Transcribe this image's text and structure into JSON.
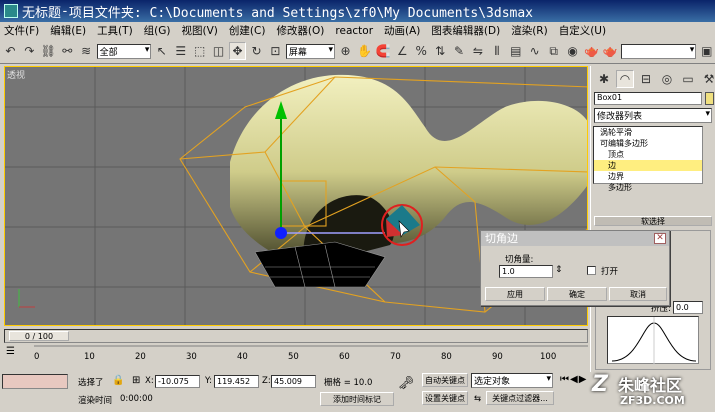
{
  "window": {
    "title_app": "无标题",
    "title_separator": " - ",
    "title_project": "项目文件夹: C:\\Documents and Settings\\zf0\\My Documents\\3dsmax"
  },
  "menu": [
    "文件(F)",
    "编辑(E)",
    "工具(T)",
    "组(G)",
    "视图(V)",
    "创建(C)",
    "修改器(O)",
    "reactor",
    "动画(A)",
    "图表编辑器(D)",
    "渲染(R)",
    "自定义(U)"
  ],
  "toolbar": {
    "selection_filter": "全部",
    "ref_coord": "屏幕",
    "named_sets": ""
  },
  "viewport": {
    "label": "透视"
  },
  "command_panel": {
    "object_name": "Box01",
    "modifier_list": "修改器列表",
    "stack": [
      {
        "label": "涡轮平滑",
        "selected": false
      },
      {
        "label": "可编辑多边形",
        "selected": false
      },
      {
        "label": "顶点",
        "selected": false
      },
      {
        "label": "边",
        "selected": true
      },
      {
        "label": "边界",
        "selected": false
      },
      {
        "label": "多边形",
        "selected": false
      }
    ],
    "rollout_title": "软选择",
    "pinch_label": "挤压:",
    "pinch_value": "0.0"
  },
  "dialog": {
    "title": "切角边",
    "amount_label": "切角量:",
    "amount_value": "1.0",
    "open_label": "打开",
    "apply": "应用",
    "ok": "确定",
    "cancel": "取消"
  },
  "timeline": {
    "frame_label": "0 / 100",
    "ticks": [
      "0",
      "10",
      "20",
      "30",
      "40",
      "50",
      "60",
      "70",
      "80",
      "90",
      "100"
    ]
  },
  "status": {
    "selected": "选择了",
    "x_label": "X:",
    "x_value": "-10.075",
    "y_label": "Y:",
    "y_value": "119.452",
    "z_label": "Z:",
    "z_value": "45.009",
    "grid": "栅格 = 10.0",
    "auto_key": "自动关键点",
    "set_key": "设置关键点",
    "selected_object": "选定对象",
    "key_filters": "关键点过滤器...",
    "render_time_label": "渲染时间",
    "render_time": "0:00:00",
    "add_time_tag": "添加时间标记"
  },
  "watermark": {
    "site": "朱峰社区",
    "url": "ZF3D.COM"
  }
}
